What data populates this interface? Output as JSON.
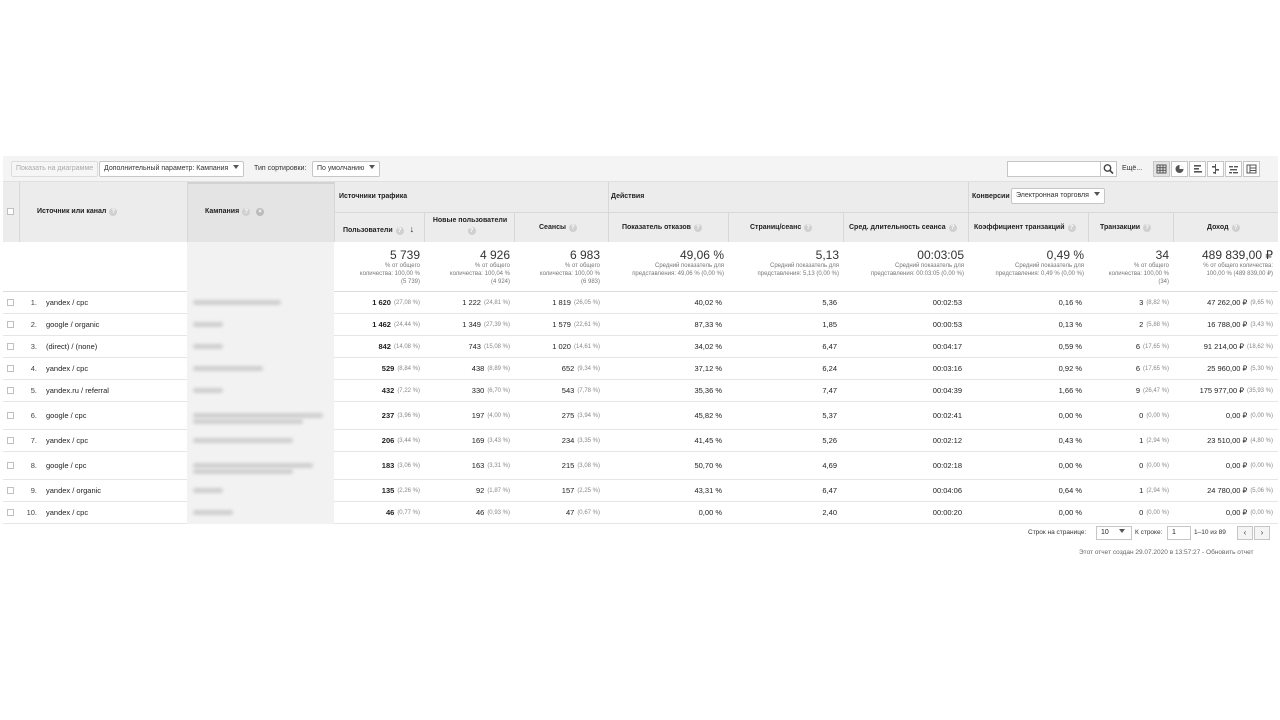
{
  "toolbar": {
    "show_on_chart": "Показать на диаграмме",
    "secondary_dim": "Дополнительный параметр: Кампания",
    "sort_label": "Тип сортировки:",
    "sort_value": "По умолчанию",
    "search_value": "",
    "more": "Ещё..."
  },
  "header": {
    "source_channel": "Источник или канал",
    "campaign": "Кампания",
    "group_traffic": "Источники трафика",
    "group_actions": "Действия",
    "group_conversions": "Конверсии",
    "conversions_select": "Электронная торговля",
    "cols": {
      "users": "Пользователи",
      "new_users": "Новые пользователи",
      "sessions": "Сеансы",
      "bounce": "Показатель отказов",
      "pages": "Страниц/сеанс",
      "duration": "Сред. длительность сеанса",
      "conv_rate": "Коэффициент транзакций",
      "transactions": "Транзакции",
      "revenue": "Доход"
    }
  },
  "totals": {
    "users": {
      "big": "5 739",
      "l1": "% от общего",
      "l2": "количества: 100,00 %",
      "l3": "(5 739)"
    },
    "new_users": {
      "big": "4 926",
      "l1": "% от общего",
      "l2": "количества: 100,04 %",
      "l3": "(4 924)"
    },
    "sessions": {
      "big": "6 983",
      "l1": "% от общего",
      "l2": "количества: 100,00 %",
      "l3": "(6 983)"
    },
    "bounce": {
      "big": "49,06 %",
      "l1": "Средний показатель для",
      "l2": "представления: 49,06 % (0,00 %)",
      "l3": ""
    },
    "pages": {
      "big": "5,13",
      "l1": "Средний показатель для",
      "l2": "представления: 5,13 (0,00 %)",
      "l3": ""
    },
    "duration": {
      "big": "00:03:05",
      "l1": "Средний показатель для",
      "l2": "представления: 00:03:05 (0,00 %)",
      "l3": ""
    },
    "conv_rate": {
      "big": "0,49 %",
      "l1": "Средний показатель для",
      "l2": "представления: 0,49 % (0,00 %)",
      "l3": ""
    },
    "transactions": {
      "big": "34",
      "l1": "% от общего",
      "l2": "количества: 100,00 %",
      "l3": "(34)"
    },
    "revenue": {
      "big": "489 839,00 ₽",
      "l1": "% от общего количества:",
      "l2": "100,00 % (489 839,00 ₽)",
      "l3": ""
    }
  },
  "rows": [
    {
      "idx": "1.",
      "source": "yandex / cpc",
      "users": "1 620",
      "users_pct": "(27,08 %)",
      "new_users": "1 222",
      "new_users_pct": "(24,81 %)",
      "sessions": "1 819",
      "sessions_pct": "(26,05 %)",
      "bounce": "40,02 %",
      "pages": "5,36",
      "duration": "00:02:53",
      "conv_rate": "0,16 %",
      "transactions": "3",
      "transactions_pct": "(8,82 %)",
      "revenue": "47 262,00 ₽",
      "revenue_pct": "(9,65 %)"
    },
    {
      "idx": "2.",
      "source": "google / organic",
      "users": "1 462",
      "users_pct": "(24,44 %)",
      "new_users": "1 349",
      "new_users_pct": "(27,39 %)",
      "sessions": "1 579",
      "sessions_pct": "(22,61 %)",
      "bounce": "87,33 %",
      "pages": "1,85",
      "duration": "00:00:53",
      "conv_rate": "0,13 %",
      "transactions": "2",
      "transactions_pct": "(5,88 %)",
      "revenue": "16 788,00 ₽",
      "revenue_pct": "(3,43 %)"
    },
    {
      "idx": "3.",
      "source": "(direct) / (none)",
      "users": "842",
      "users_pct": "(14,08 %)",
      "new_users": "743",
      "new_users_pct": "(15,08 %)",
      "sessions": "1 020",
      "sessions_pct": "(14,61 %)",
      "bounce": "34,02 %",
      "pages": "6,47",
      "duration": "00:04:17",
      "conv_rate": "0,59 %",
      "transactions": "6",
      "transactions_pct": "(17,65 %)",
      "revenue": "91 214,00 ₽",
      "revenue_pct": "(18,62 %)"
    },
    {
      "idx": "4.",
      "source": "yandex / cpc",
      "users": "529",
      "users_pct": "(8,84 %)",
      "new_users": "438",
      "new_users_pct": "(8,89 %)",
      "sessions": "652",
      "sessions_pct": "(9,34 %)",
      "bounce": "37,12 %",
      "pages": "6,24",
      "duration": "00:03:16",
      "conv_rate": "0,92 %",
      "transactions": "6",
      "transactions_pct": "(17,65 %)",
      "revenue": "25 960,00 ₽",
      "revenue_pct": "(5,30 %)"
    },
    {
      "idx": "5.",
      "source": "yandex.ru / referral",
      "users": "432",
      "users_pct": "(7,22 %)",
      "new_users": "330",
      "new_users_pct": "(6,70 %)",
      "sessions": "543",
      "sessions_pct": "(7,78 %)",
      "bounce": "35,36 %",
      "pages": "7,47",
      "duration": "00:04:39",
      "conv_rate": "1,66 %",
      "transactions": "9",
      "transactions_pct": "(26,47 %)",
      "revenue": "175 977,00 ₽",
      "revenue_pct": "(35,93 %)"
    },
    {
      "idx": "6.",
      "source": "google / cpc",
      "users": "237",
      "users_pct": "(3,96 %)",
      "new_users": "197",
      "new_users_pct": "(4,00 %)",
      "sessions": "275",
      "sessions_pct": "(3,94 %)",
      "bounce": "45,82 %",
      "pages": "5,37",
      "duration": "00:02:41",
      "conv_rate": "0,00 %",
      "transactions": "0",
      "transactions_pct": "(0,00 %)",
      "revenue": "0,00 ₽",
      "revenue_pct": "(0,00 %)"
    },
    {
      "idx": "7.",
      "source": "yandex / cpc",
      "users": "206",
      "users_pct": "(3,44 %)",
      "new_users": "169",
      "new_users_pct": "(3,43 %)",
      "sessions": "234",
      "sessions_pct": "(3,35 %)",
      "bounce": "41,45 %",
      "pages": "5,26",
      "duration": "00:02:12",
      "conv_rate": "0,43 %",
      "transactions": "1",
      "transactions_pct": "(2,94 %)",
      "revenue": "23 510,00 ₽",
      "revenue_pct": "(4,80 %)"
    },
    {
      "idx": "8.",
      "source": "google / cpc",
      "users": "183",
      "users_pct": "(3,06 %)",
      "new_users": "163",
      "new_users_pct": "(3,31 %)",
      "sessions": "215",
      "sessions_pct": "(3,08 %)",
      "bounce": "50,70 %",
      "pages": "4,69",
      "duration": "00:02:18",
      "conv_rate": "0,00 %",
      "transactions": "0",
      "transactions_pct": "(0,00 %)",
      "revenue": "0,00 ₽",
      "revenue_pct": "(0,00 %)"
    },
    {
      "idx": "9.",
      "source": "yandex / organic",
      "users": "135",
      "users_pct": "(2,26 %)",
      "new_users": "92",
      "new_users_pct": "(1,87 %)",
      "sessions": "157",
      "sessions_pct": "(2,25 %)",
      "bounce": "43,31 %",
      "pages": "6,47",
      "duration": "00:04:06",
      "conv_rate": "0,64 %",
      "transactions": "1",
      "transactions_pct": "(2,94 %)",
      "revenue": "24 780,00 ₽",
      "revenue_pct": "(5,06 %)"
    },
    {
      "idx": "10.",
      "source": "yandex / cpc",
      "users": "46",
      "users_pct": "(0,77 %)",
      "new_users": "46",
      "new_users_pct": "(0,93 %)",
      "sessions": "47",
      "sessions_pct": "(0,67 %)",
      "bounce": "0,00 %",
      "pages": "2,40",
      "duration": "00:00:20",
      "conv_rate": "0,00 %",
      "transactions": "0",
      "transactions_pct": "(0,00 %)",
      "revenue": "0,00 ₽",
      "revenue_pct": "(0,00 %)"
    }
  ],
  "footer": {
    "rows_per_page_label": "Строк на странице:",
    "rows_per_page": "10",
    "goto_label": "К строке:",
    "goto_value": "1",
    "range": "1–10 из 89",
    "prev": "‹",
    "next": "›",
    "report_info": "Этот отчет создан 29.07.2020 в 13:57:27 - Обновить отчет"
  },
  "icons": [
    "search-icon",
    "view-table-icon",
    "view-pie-icon",
    "view-bar-icon",
    "view-comparison-icon",
    "view-pivot-icon",
    "view-term-cloud-icon",
    "help-icon",
    "sort-desc-icon",
    "remove-dimension-icon"
  ]
}
